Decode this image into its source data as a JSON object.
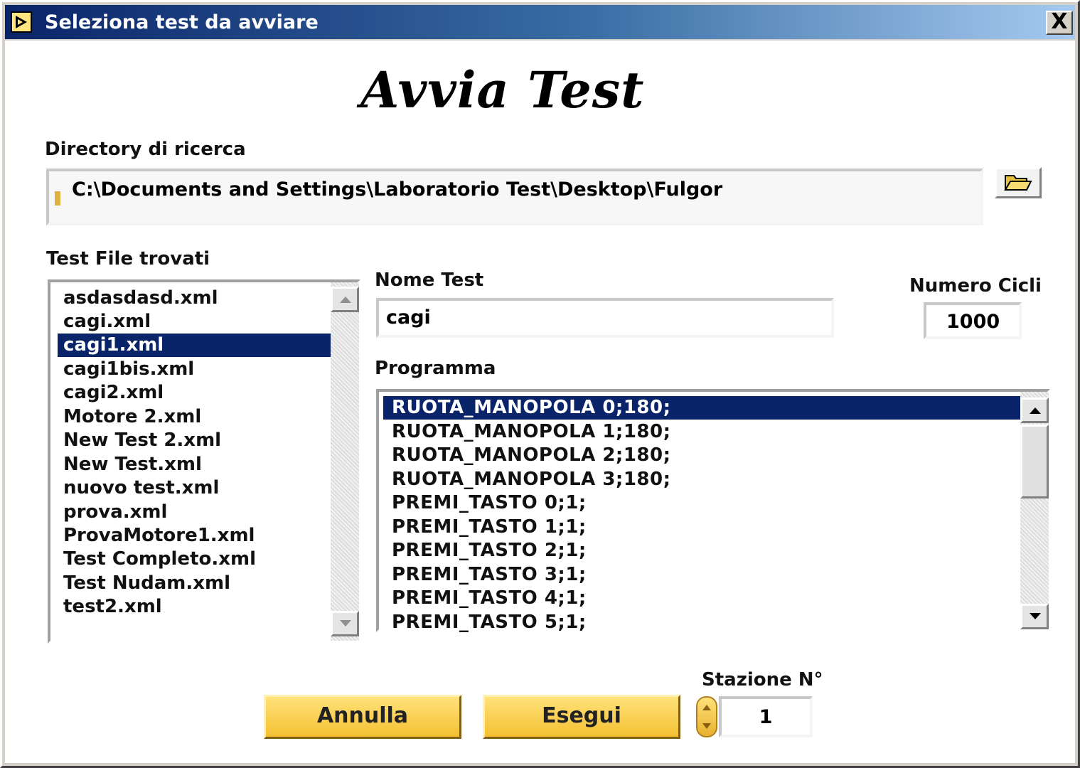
{
  "window": {
    "title": "Seleziona test da avviare",
    "close_label": "X"
  },
  "heading": "Avvia Test",
  "directory": {
    "label": "Directory di ricerca",
    "value": "C:\\Documents and Settings\\Laboratorio Test\\Desktop\\Fulgor",
    "browse_icon": "folder-open-icon"
  },
  "files": {
    "label": "Test File trovati",
    "items": [
      "asdasdasd.xml",
      "cagi.xml",
      "cagi1.xml",
      "cagi1bis.xml",
      "cagi2.xml",
      "Motore 2.xml",
      "New Test 2.xml",
      "New Test.xml",
      "nuovo test.xml",
      "prova.xml",
      "ProvaMotore1.xml",
      "Test Completo.xml",
      "Test Nudam.xml",
      "test2.xml"
    ],
    "selected_index": 2
  },
  "nome_test": {
    "label": "Nome Test",
    "value": "cagi"
  },
  "numero_cicli": {
    "label": "Numero Cicli",
    "value": "1000"
  },
  "programma": {
    "label": "Programma",
    "items": [
      "RUOTA_MANOPOLA 0;180;",
      "RUOTA_MANOPOLA 1;180;",
      "RUOTA_MANOPOLA 2;180;",
      "RUOTA_MANOPOLA 3;180;",
      "PREMI_TASTO 0;1;",
      "PREMI_TASTO 1;1;",
      "PREMI_TASTO 2;1;",
      "PREMI_TASTO 3;1;",
      "PREMI_TASTO 4;1;",
      "PREMI_TASTO 5;1;"
    ],
    "selected_index": 0
  },
  "buttons": {
    "cancel": "Annulla",
    "run": "Esegui"
  },
  "stazione": {
    "label": "Stazione N°",
    "value": "1"
  },
  "colors": {
    "selection": "#0a246a",
    "button_gold": "#f4c032"
  }
}
